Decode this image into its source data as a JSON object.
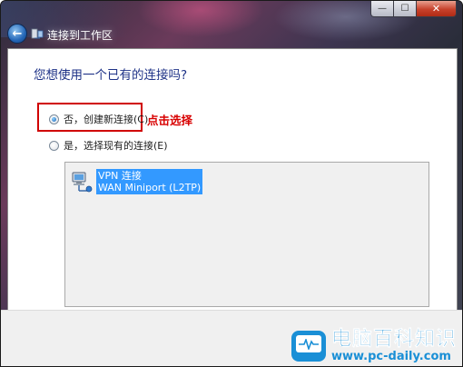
{
  "window": {
    "title": "连接到工作区",
    "caption": {
      "minimize": "—",
      "maximize": "☐",
      "close": "✕"
    }
  },
  "main": {
    "question": "您想使用一个已有的连接吗?",
    "options": [
      {
        "label": "否，创建新连接(C)",
        "checked": true
      },
      {
        "label": "是，选择现有的连接(E)",
        "checked": false
      }
    ],
    "annotation": "点击选择",
    "connections": [
      {
        "name": "VPN 连接",
        "device": "WAN Miniport (L2TP)",
        "selected": true
      }
    ]
  },
  "watermark": {
    "title": "电脑百科知识",
    "url": "www.pc-daily.com"
  },
  "colors": {
    "question_text": "#1e3287",
    "annotation": "#d80000",
    "selection": "#3399ff",
    "watermark": "#1a8fd6"
  }
}
